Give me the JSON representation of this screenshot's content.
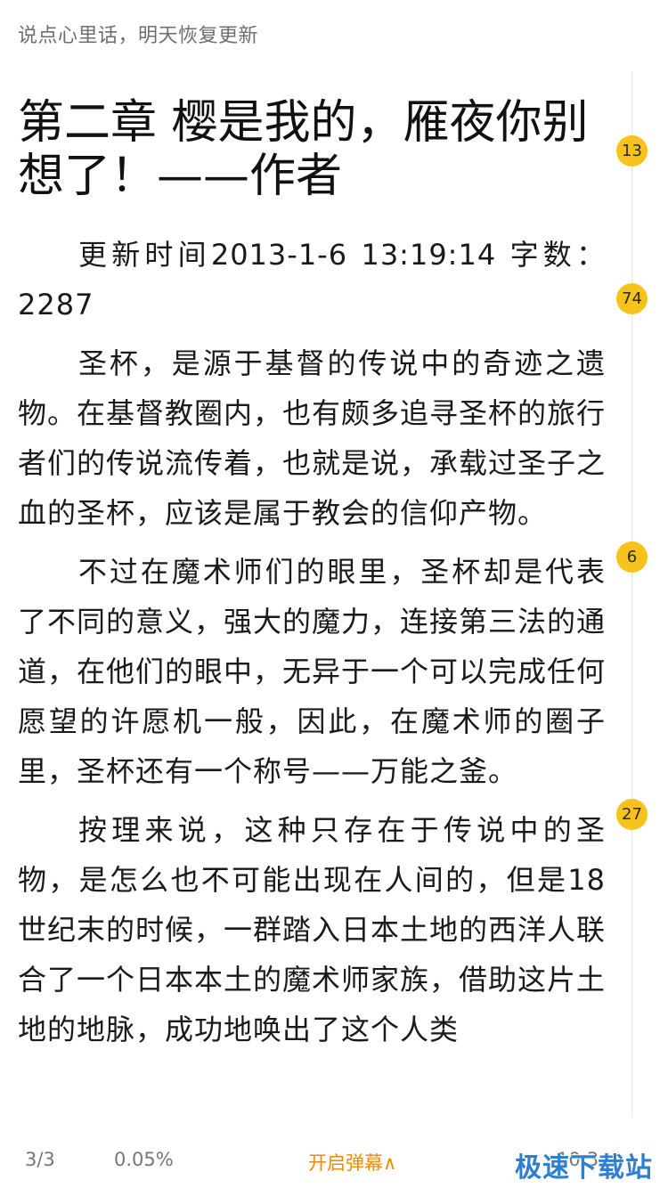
{
  "top_note": "说点心里话，明天恢复更新",
  "chapter": {
    "title": "第二章 樱是我的，雁夜你别想了！——作者",
    "meta": "更新时间2013-1-6 13:19:14  字数：2287",
    "paragraphs": [
      "圣杯，是源于基督的传说中的奇迹之遗物。在基督教圈内，也有颇多追寻圣杯的旅行者们的传说流传着，也就是说，承载过圣子之血的圣杯，应该是属于教会的信仰产物。",
      "不过在魔术师们的眼里，圣杯却是代表了不同的意义，强大的魔力，连接第三法的通道，在他们的眼中，无异于一个可以完成任何愿望的许愿机一般，因此，在魔术师的圈子里，圣杯还有一个称号——万能之釜。",
      "按理来说，这种只存在于传说中的圣物，是怎么也不可能出现在人间的，但是18世纪末的时候，一群踏入日本土地的西洋人联合了一个日本本土的魔术师家族，借助这片土地的地脉，成功地唤出了这个人类"
    ]
  },
  "comment_bubbles": [
    "13",
    "74",
    "6",
    "27"
  ],
  "footer": {
    "page": "3/3",
    "progress": "0.05%",
    "danmaku": "开启弹幕∧",
    "time": "10:3"
  },
  "watermark": "极速下载站",
  "colors": {
    "bubble": "#f7c21b",
    "danmaku": "#f08a00"
  }
}
